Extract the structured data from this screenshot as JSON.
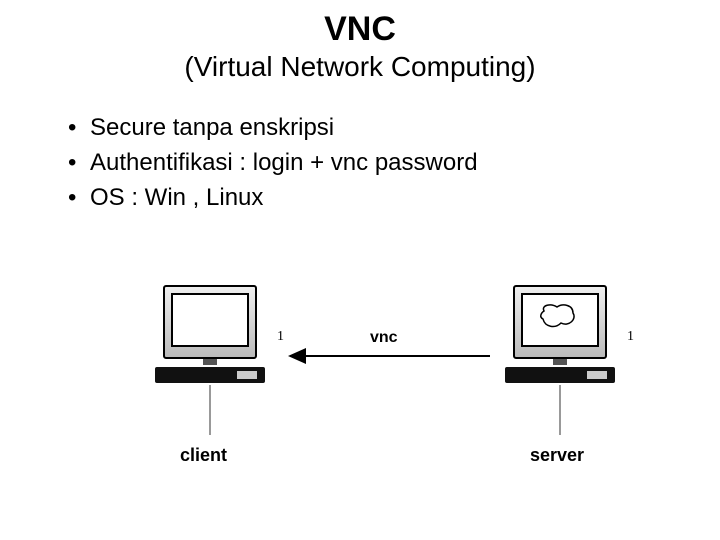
{
  "title": "VNC",
  "subtitle": "(Virtual Network Computing)",
  "bullets": [
    "Secure tanpa enskripsi",
    "Authentifikasi : login + vnc password",
    "OS : Win , Linux"
  ],
  "diagram": {
    "arrow_label": "vnc",
    "left_label": "client",
    "right_label": "server",
    "side_mark": "1"
  }
}
